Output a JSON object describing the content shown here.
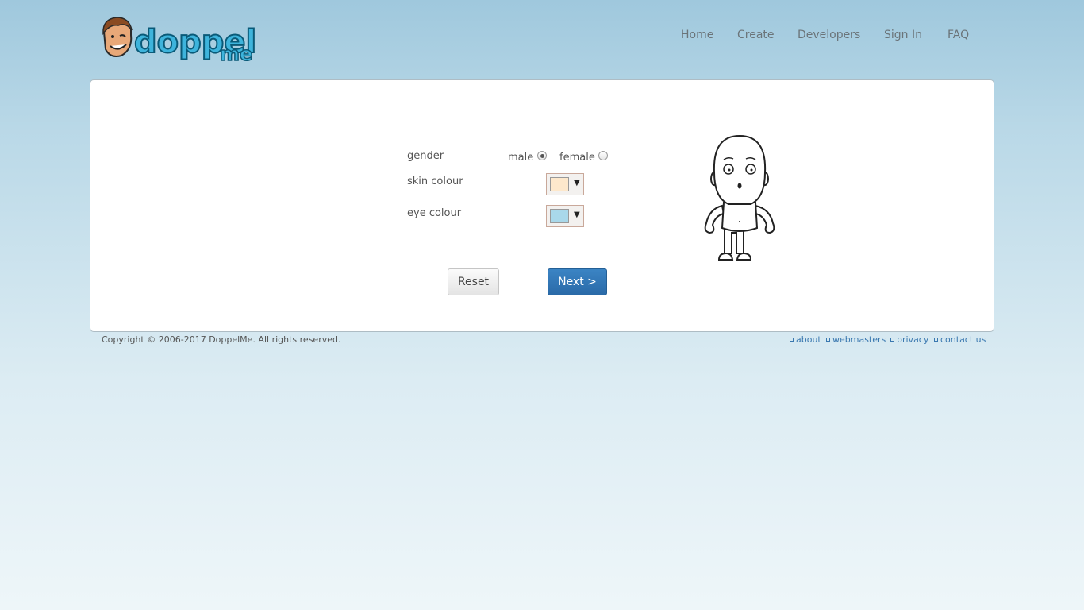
{
  "brand": {
    "logo_text_1": "doppel",
    "logo_text_2": "me"
  },
  "nav": {
    "home": "Home",
    "create": "Create",
    "developers": "Developers",
    "sign_in": "Sign In",
    "faq": "FAQ"
  },
  "form": {
    "gender_label": "gender",
    "gender_options": [
      "male",
      "female"
    ],
    "gender_selected": "male",
    "skin_label": "skin colour",
    "skin_color": "#fde8cc",
    "eye_label": "eye colour",
    "eye_color": "#a9d8ea",
    "dropdown_arrow": "▼",
    "reset_label": "Reset",
    "next_label": "Next >"
  },
  "footer": {
    "copyright": "Copyright © 2006-2017 DoppelMe. All rights reserved.",
    "links": [
      "about",
      "webmasters",
      "privacy",
      "contact us"
    ]
  }
}
